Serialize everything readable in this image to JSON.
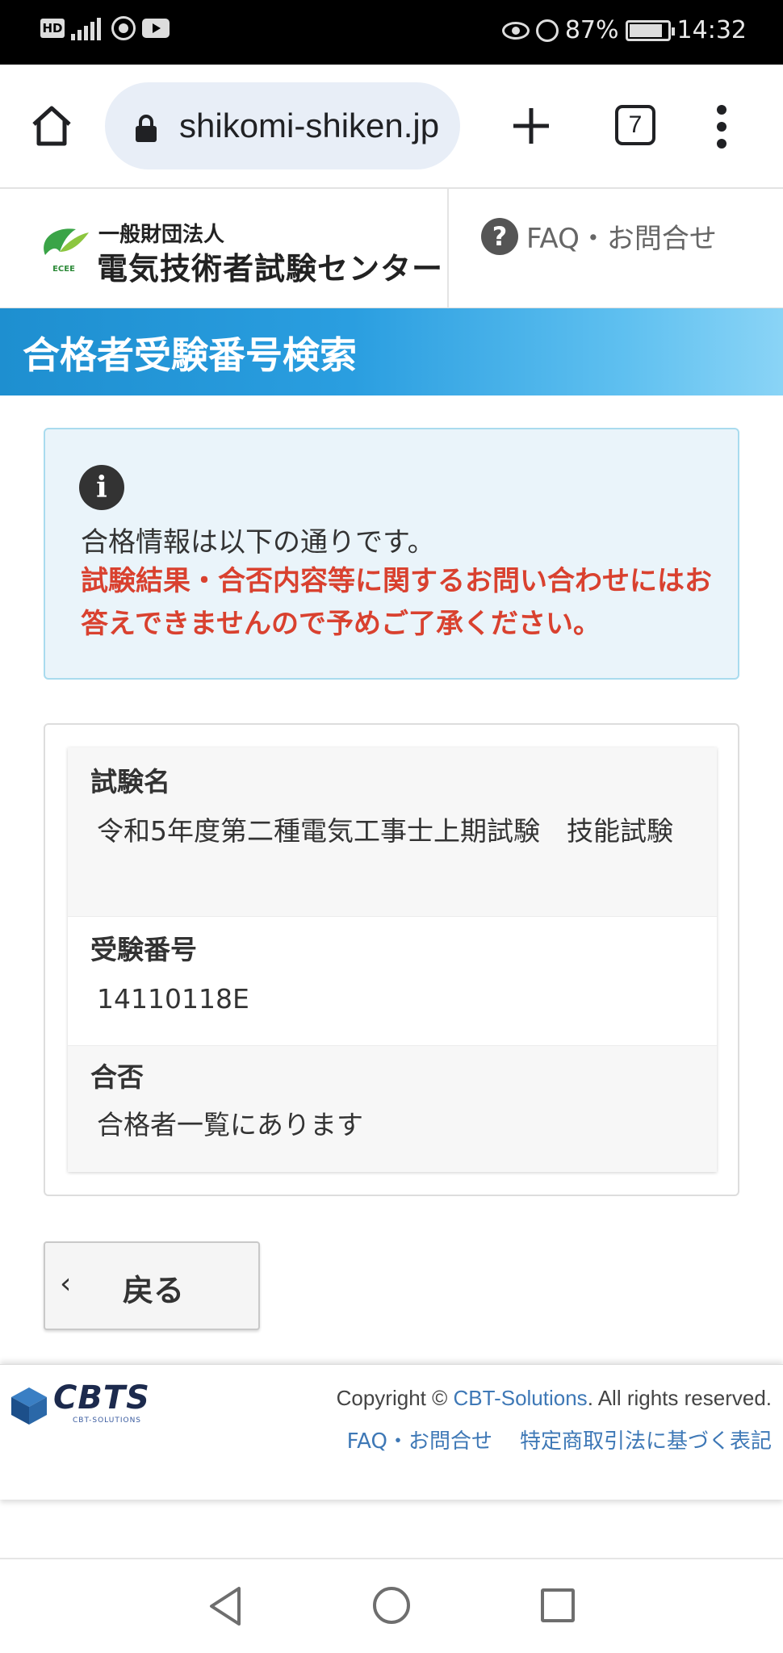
{
  "status_bar": {
    "network": "4G",
    "hd": "HD",
    "battery": "87%",
    "time": "14:32"
  },
  "browser": {
    "url": "shikomi-shiken.jp",
    "tab_count": "7"
  },
  "site_header": {
    "org_sub": "一般財団法人",
    "org_name": "電気技術者試験センター",
    "logo_mark_text": "ECEE",
    "faq_label": "FAQ・お問合せ"
  },
  "banner": {
    "title": "合格者受験番号検索"
  },
  "notice": {
    "text": "合格情報は以下の通りです。",
    "warning": "試験結果・合否内容等に関するお問い合わせにはお答えできませんので予めご了承ください。"
  },
  "result": {
    "rows": [
      {
        "label": "試験名",
        "value": "令和5年度第二種電気工事士上期試験　技能試験"
      },
      {
        "label": "受験番号",
        "value": "14110118E"
      },
      {
        "label": "合否",
        "value": "合格者一覧にあります"
      }
    ]
  },
  "back_button": {
    "label": "戻る"
  },
  "footer": {
    "logo_text": "CBTS",
    "logo_sub": "CBT-SOLUTIONS",
    "copyright_prefix": "Copyright © ",
    "copyright_link": "CBT-Solutions",
    "copyright_suffix": ". All rights reserved.",
    "links": [
      "FAQ・お問合せ",
      "特定商取引法に基づく表記"
    ]
  },
  "colors": {
    "banner": "#1e8fd0",
    "warning_red": "#d9412f",
    "link_blue": "#3e78b6",
    "info_bg": "#eaf4fa"
  },
  "icons": [
    "home-icon",
    "lock-icon",
    "plus-icon",
    "tabs-icon",
    "menu-icon",
    "question-icon",
    "info-icon",
    "chevron-left-icon",
    "nav-back-icon",
    "nav-home-icon",
    "nav-recent-icon"
  ]
}
